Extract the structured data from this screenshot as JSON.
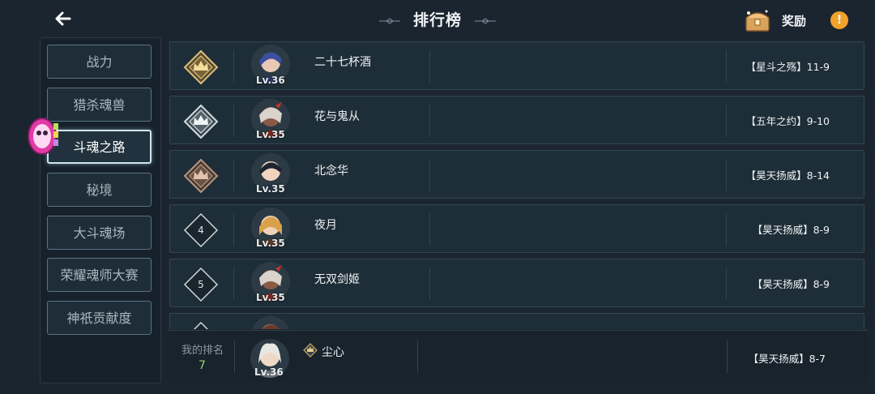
{
  "header": {
    "title": "排行榜",
    "reward_label": "奖励",
    "info_label": "!"
  },
  "sidebar": {
    "items": [
      {
        "label": "战力",
        "active": false
      },
      {
        "label": "猎杀魂兽",
        "active": false
      },
      {
        "label": "斗魂之路",
        "active": true
      },
      {
        "label": "秘境",
        "active": false
      },
      {
        "label": "大斗魂场",
        "active": false
      },
      {
        "label": "荣耀魂师大赛",
        "active": false
      },
      {
        "label": "神祇贡献度",
        "active": false
      }
    ]
  },
  "ranking": {
    "rows": [
      {
        "rank": "1",
        "badge": "gold-crown",
        "level": "Lv.36",
        "name": "二十七杯酒",
        "stage": "【星斗之殇】11-9"
      },
      {
        "rank": "2",
        "badge": "silver-crown",
        "level": "Lv.35",
        "name": "花与鬼从",
        "stage": "【五年之约】9-10"
      },
      {
        "rank": "3",
        "badge": "bronze-crown",
        "level": "Lv.35",
        "name": "北念华",
        "stage": "【昊天扬威】8-14"
      },
      {
        "rank": "4",
        "badge": "number",
        "level": "Lv.35",
        "name": "夜月",
        "stage": "【昊天扬威】8-9"
      },
      {
        "rank": "5",
        "badge": "number",
        "level": "Lv.35",
        "name": "无双剑姬",
        "stage": "【昊天扬威】8-9"
      }
    ]
  },
  "my_rank": {
    "label": "我的排名",
    "rank": "7",
    "level": "Lv.36",
    "name": "尘心",
    "stage": "【昊天扬威】8-7"
  },
  "colors": {
    "accent_gold": "#c9a760",
    "silver": "#c5ced4",
    "bronze": "#a07f6a",
    "my_rank_green": "#9bd46a"
  }
}
